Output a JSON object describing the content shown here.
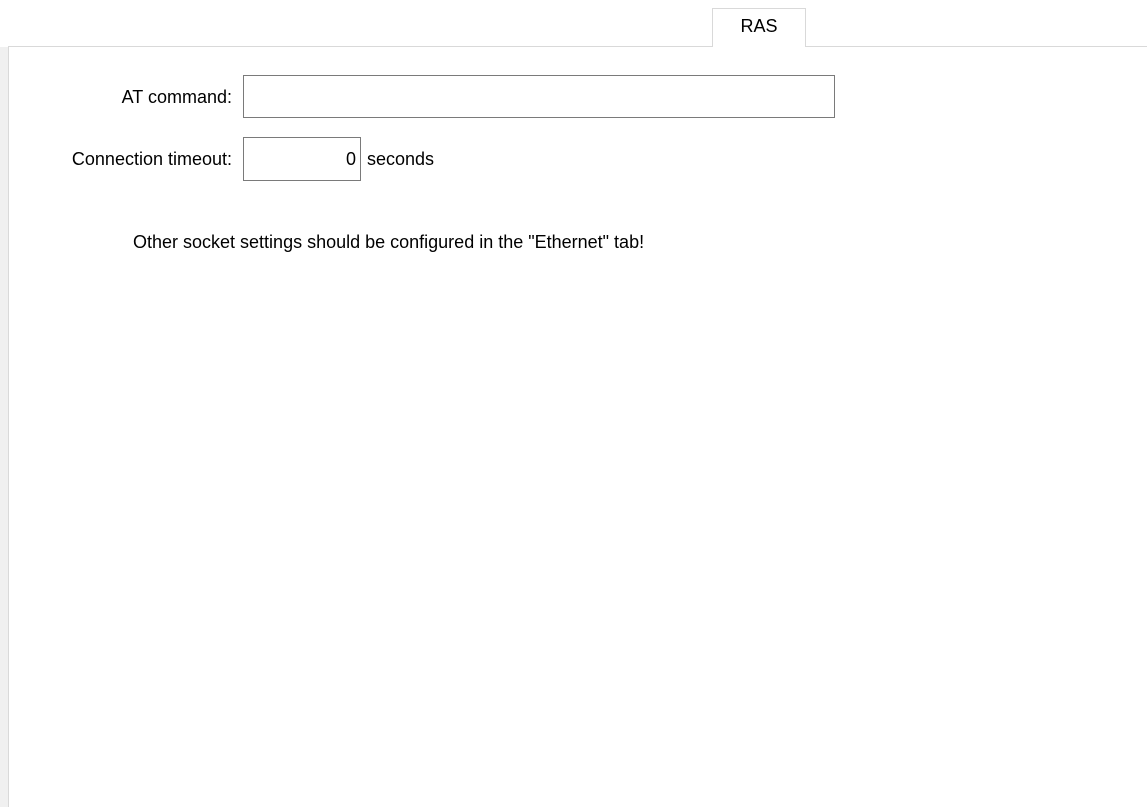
{
  "tabs": [
    {
      "label": "RAS",
      "selected": true
    }
  ],
  "form": {
    "at_command": {
      "label": "AT command:",
      "value": ""
    },
    "connection_timeout": {
      "label": "Connection timeout:",
      "value": "0",
      "unit": "seconds"
    }
  },
  "note": "Other socket settings should be configured in the \"Ethernet\" tab!"
}
